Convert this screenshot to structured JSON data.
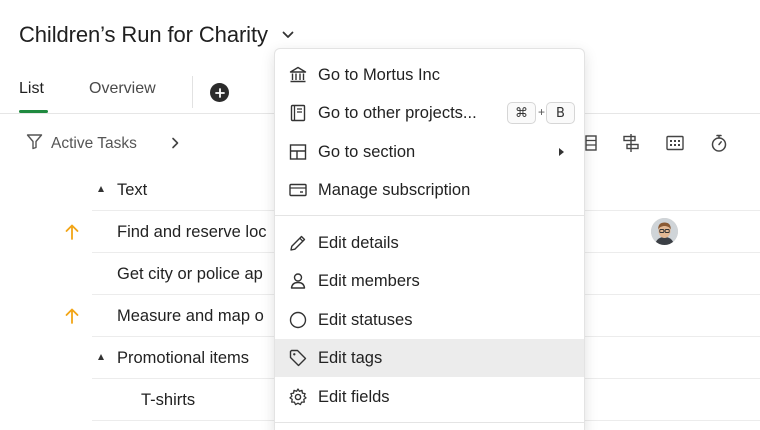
{
  "project": {
    "title": "Children’s Run for Charity"
  },
  "tabs": [
    {
      "label": "List",
      "active": true
    },
    {
      "label": "Overview",
      "active": false
    }
  ],
  "toolbar": {
    "filter_label": "Active Tasks"
  },
  "rows": [
    {
      "text": "Text",
      "type": "section"
    },
    {
      "text": "Find and reserve loc",
      "priority": "up-arrow",
      "has_avatar": true
    },
    {
      "text": "Get city or police ap"
    },
    {
      "text": "Measure and map o",
      "priority": "up-arrow"
    },
    {
      "text": "Promotional items",
      "type": "section"
    },
    {
      "text": "T-shirts",
      "type": "subtask"
    }
  ],
  "menu": {
    "items": [
      {
        "label": "Go to Mortus Inc",
        "icon": "bank-icon"
      },
      {
        "label": "Go to other projects...",
        "icon": "book-icon",
        "shortcut": [
          "⌘",
          "B"
        ],
        "shortcut_join": "+"
      },
      {
        "label": "Go to section",
        "icon": "layout-icon",
        "submenu": true
      },
      {
        "label": "Manage subscription",
        "icon": "credit-card-icon"
      },
      {
        "label": "Edit details",
        "icon": "pencil-icon"
      },
      {
        "label": "Edit members",
        "icon": "user-icon"
      },
      {
        "label": "Edit statuses",
        "icon": "circle-icon"
      },
      {
        "label": "Edit tags",
        "icon": "tag-icon",
        "highlighted": true
      },
      {
        "label": "Edit fields",
        "icon": "gear-icon"
      }
    ]
  },
  "colors": {
    "accent_green": "#1f8a3f",
    "priority_orange": "#f2a516",
    "menu_highlight": "#ececec"
  }
}
